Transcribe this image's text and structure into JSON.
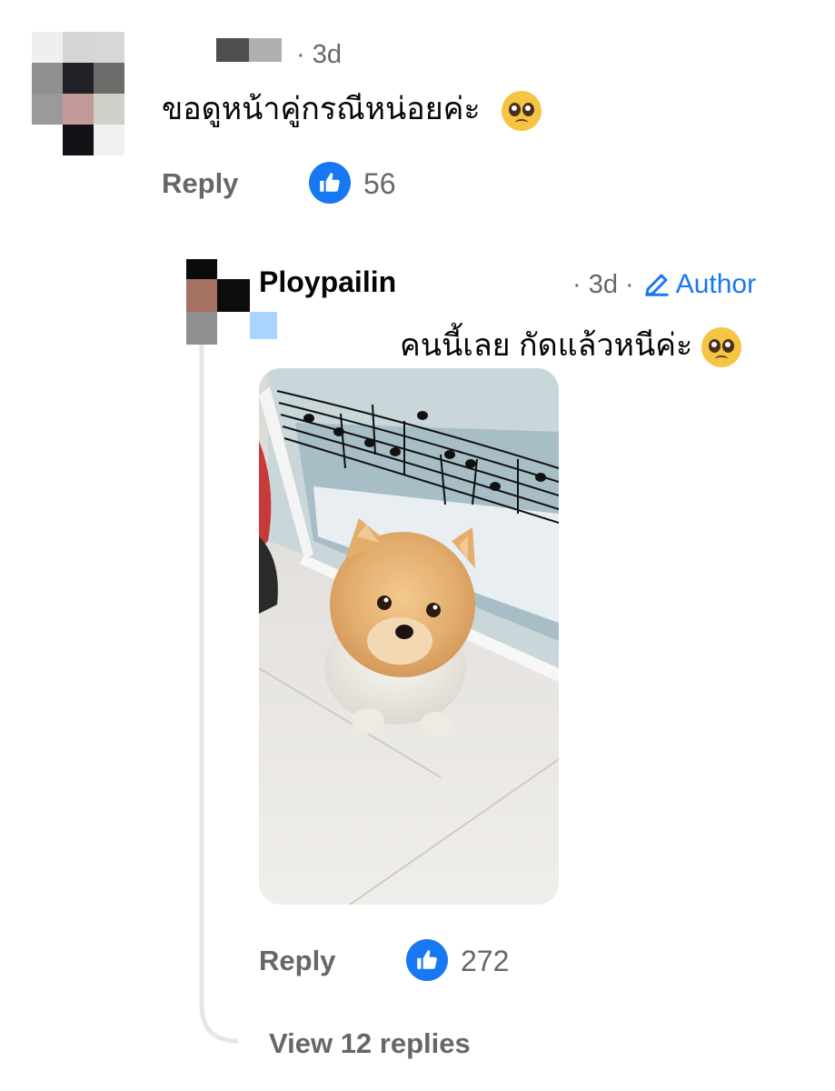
{
  "comment": {
    "author_name_redacted": "",
    "time": "· 3d",
    "text": "ขอดูหน้าคู่กรณีหน่อยค่ะ",
    "emoji": "pleading-face-emoji",
    "reply_label": "Reply",
    "like_count": "56"
  },
  "reply": {
    "author": "Ploypailin",
    "time": "· 3d ·",
    "badge": "Author",
    "text": "คนนี้เลย กัดแล้วหนีค่ะ",
    "emoji": "pleading-face-emoji",
    "photo_icon": "pomeranian-dog-photo",
    "reply_label": "Reply",
    "like_count": "272"
  },
  "view_replies": "View 12 replies",
  "colors": {
    "like_blue": "#1877f2",
    "secondary_text": "#65676b"
  }
}
